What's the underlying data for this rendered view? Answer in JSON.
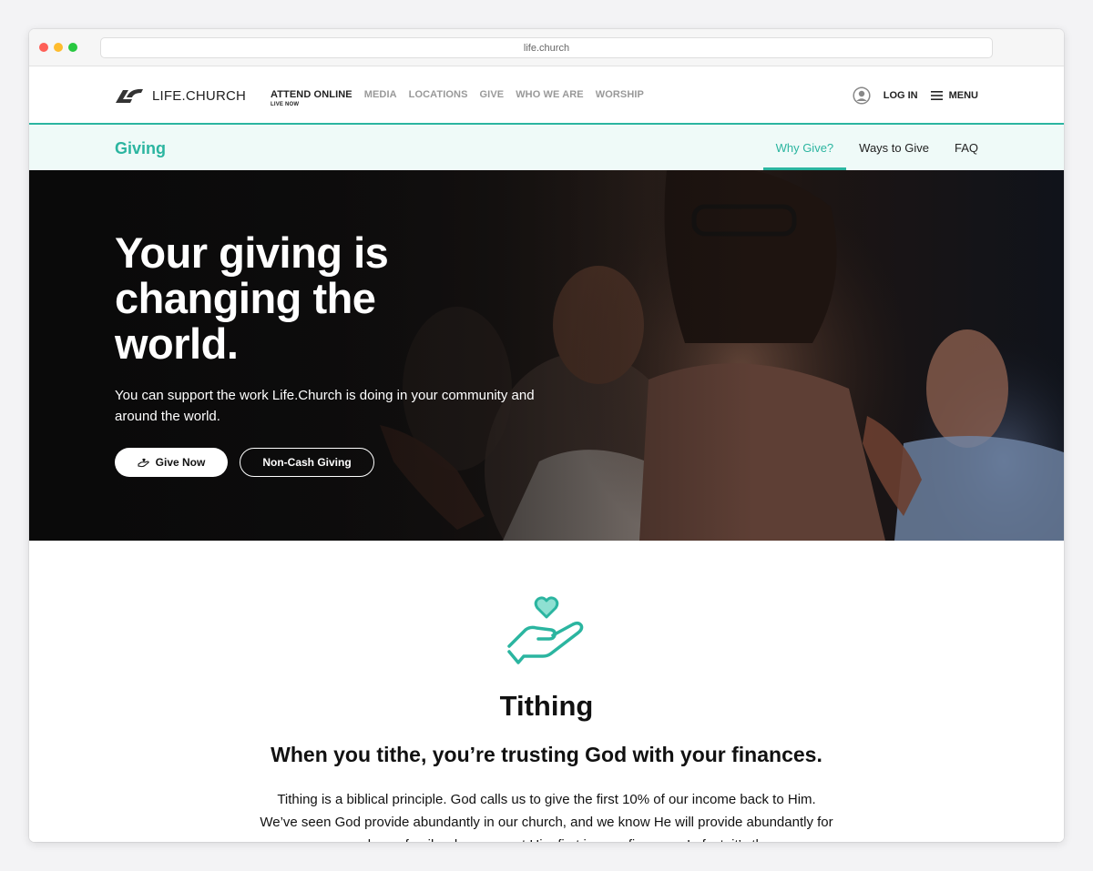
{
  "browser": {
    "url": "life.church"
  },
  "header": {
    "logo_text": "LIFE.CHURCH",
    "nav": [
      {
        "label": "ATTEND ONLINE",
        "sub": "LIVE NOW"
      },
      {
        "label": "MEDIA"
      },
      {
        "label": "LOCATIONS"
      },
      {
        "label": "GIVE"
      },
      {
        "label": "WHO WE ARE"
      },
      {
        "label": "WORSHIP"
      }
    ],
    "login_label": "LOG IN",
    "menu_label": "MENU"
  },
  "subnav": {
    "title": "Giving",
    "tabs": [
      {
        "label": "Why Give?"
      },
      {
        "label": "Ways to Give"
      },
      {
        "label": "FAQ"
      }
    ]
  },
  "hero": {
    "title": "Your giving is changing the world.",
    "subtitle": "You can support the work Life.Church is doing in your community and around the world.",
    "primary_button": "Give Now",
    "secondary_button": "Non-Cash Giving"
  },
  "section": {
    "title": "Tithing",
    "subtitle": "When you tithe, you’re trusting God with your finances.",
    "body": "Tithing is a biblical principle. God calls us to give the first 10% of our income back to Him. We’ve seen God provide abundantly in our church, and we know He will provide abundantly for you and your family when you put Him first in your finances. In fact, it’s the"
  },
  "colors": {
    "accent": "#2bb5a0",
    "subnav_bg": "#effaf8"
  },
  "icons": [
    "logo-mark-icon",
    "user-icon",
    "menu-icon",
    "hand-icon",
    "heart-hand-icon"
  ]
}
